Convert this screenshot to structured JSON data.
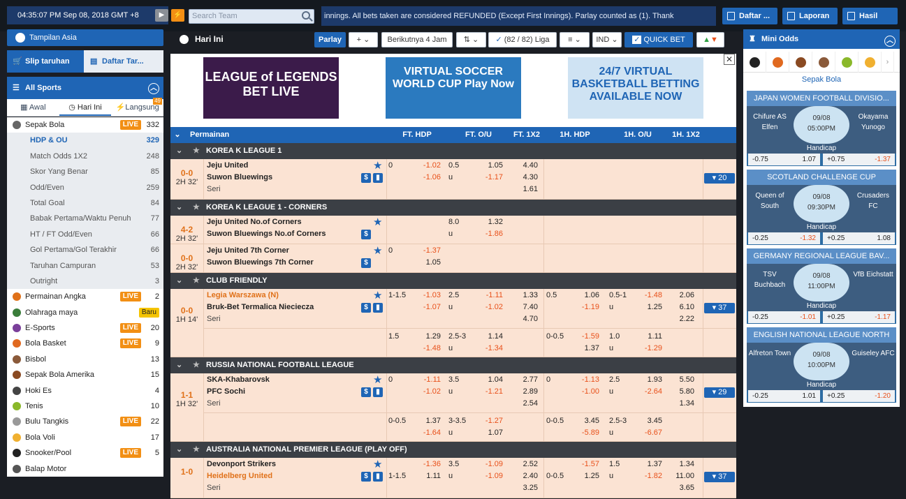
{
  "topbar": {
    "clock": "04:35:07 PM Sep 08, 2018 GMT +8",
    "search_placeholder": "Search Team",
    "ticker": "innings. All bets taken are considered REFUNDED (Except First Innings). Parlay counted as (1). Thank",
    "daftar": "Daftar ...",
    "laporan": "Laporan",
    "hasil": "Hasil"
  },
  "left": {
    "tampilan": "Tampilan Asia",
    "slip": "Slip taruhan",
    "daftar": "Daftar Tar...",
    "all_sports": "All Sports",
    "tabs": [
      "Awal",
      "Hari Ini",
      "Langsung"
    ],
    "langsung_badge": "49",
    "sports": [
      {
        "name": "Sepak Bola",
        "count": "332",
        "live": "LIVE",
        "type": "main"
      },
      {
        "name": "HDP & OU",
        "count": "329",
        "type": "sub-sel"
      },
      {
        "name": "Match Odds 1X2",
        "count": "248",
        "type": "sub"
      },
      {
        "name": "Skor Yang Benar",
        "count": "85",
        "type": "sub"
      },
      {
        "name": "Odd/Even",
        "count": "259",
        "type": "sub"
      },
      {
        "name": "Total Goal",
        "count": "84",
        "type": "sub"
      },
      {
        "name": "Babak Pertama/Waktu Penuh",
        "count": "77",
        "type": "sub"
      },
      {
        "name": "HT / FT Odd/Even",
        "count": "66",
        "type": "sub"
      },
      {
        "name": "Gol Pertama/Gol Terakhir",
        "count": "66",
        "type": "sub"
      },
      {
        "name": "Taruhan Campuran",
        "count": "53",
        "type": "sub"
      },
      {
        "name": "Outright",
        "count": "3",
        "type": "sub"
      },
      {
        "name": "Permainan Angka",
        "count": "2",
        "live": "LIVE",
        "type": "main",
        "color": "#e07119"
      },
      {
        "name": "Olahraga maya",
        "count": "",
        "baru": "Baru",
        "type": "main",
        "color": "#3a7d3a"
      },
      {
        "name": "E-Sports",
        "count": "20",
        "live": "LIVE",
        "type": "main",
        "color": "#7a3f9a"
      },
      {
        "name": "Bola Basket",
        "count": "9",
        "live": "LIVE",
        "type": "main",
        "color": "#e0691f"
      },
      {
        "name": "Bisbol",
        "count": "13",
        "type": "main",
        "color": "#8a5a3a"
      },
      {
        "name": "Sepak Bola Amerika",
        "count": "15",
        "type": "main",
        "color": "#8a4a22"
      },
      {
        "name": "Hoki Es",
        "count": "4",
        "type": "main",
        "color": "#444"
      },
      {
        "name": "Tenis",
        "count": "10",
        "type": "main",
        "color": "#8ab82a"
      },
      {
        "name": "Bulu Tangkis",
        "count": "22",
        "live": "LIVE",
        "type": "main",
        "color": "#999"
      },
      {
        "name": "Bola Voli",
        "count": "17",
        "type": "main",
        "color": "#f0b030"
      },
      {
        "name": "Snooker/Pool",
        "count": "5",
        "live": "LIVE",
        "type": "main",
        "color": "#222"
      },
      {
        "name": "Balap Motor",
        "count": "",
        "type": "main",
        "color": "#555"
      }
    ]
  },
  "center": {
    "title": "Hari Ini",
    "parlay": "Parlay",
    "plus": "+",
    "berikutnya": "Berikutnya 4 Jam",
    "liga": "(82 / 82) Liga",
    "ind": "IND",
    "quickbet": "QUICK BET",
    "banners": [
      "LEAGUE of LEGENDS BET LIVE",
      "VIRTUAL SOCCER WORLD CUP Play Now",
      "24/7 VIRTUAL BASKETBALL BETTING AVAILABLE NOW"
    ],
    "headers": [
      "Permainan",
      "FT. HDP",
      "FT. O/U",
      "FT. 1X2",
      "1H. HDP",
      "1H. O/U",
      "1H. 1X2"
    ]
  },
  "leagues": [
    {
      "name": "KOREA K LEAGUE 1",
      "matches": [
        {
          "score": "0-0",
          "time": "2H 32'",
          "h": "Jeju United",
          "a": "Suwon Bluewings",
          "seri": "Seri",
          "more": "20",
          "lines": [
            [
              "0",
              "-1.02",
              "0.5",
              "1.05",
              "4.40",
              "",
              "",
              "",
              "",
              "",
              ""
            ],
            [
              "",
              "-1.06",
              "u",
              "-1.17",
              "4.30",
              "",
              "",
              "",
              "",
              "",
              ""
            ],
            [
              "",
              "",
              "",
              "",
              "1.61",
              "",
              "",
              "",
              "",
              "",
              ""
            ]
          ]
        }
      ]
    },
    {
      "name": "KOREA K LEAGUE 1 - CORNERS",
      "matches": [
        {
          "score": "4-2",
          "time": "2H 32'",
          "h": "Jeju United No.of Corners",
          "a": "Suwon Bluewings No.of Corners",
          "lines": [
            [
              "",
              "",
              "8.0",
              "1.32"
            ],
            [
              "",
              "",
              "u",
              "-1.86"
            ]
          ]
        },
        {
          "score": "0-0",
          "time": "2H 32'",
          "h": "Jeju United 7th Corner",
          "a": "Suwon Bluewings 7th Corner",
          "lines": [
            [
              "0",
              "-1.37"
            ],
            [
              "",
              "1.05"
            ]
          ]
        }
      ]
    },
    {
      "name": "CLUB FRIENDLY",
      "matches": [
        {
          "score": "0-0",
          "time": "1H 14'",
          "h": "Legia Warszawa (N)",
          "a": "Bruk-Bet Termalica Nieciecza",
          "seri": "Seri",
          "more": "37",
          "lines": [
            [
              "1-1.5",
              "-1.03",
              "2.5",
              "-1.11",
              "1.33",
              "0.5",
              "1.06",
              "0.5-1",
              "-1.48",
              "2.06"
            ],
            [
              "",
              "-1.07",
              "u",
              "-1.02",
              "7.40",
              "",
              "-1.19",
              "u",
              "1.25",
              "6.10"
            ],
            [
              "",
              "",
              "",
              "",
              "4.70",
              "",
              "",
              "",
              "",
              "2.22"
            ],
            [
              "1.5",
              "1.29",
              "2.5-3",
              "1.14",
              "",
              "0-0.5",
              "-1.59",
              "1.0",
              "1.11",
              ""
            ],
            [
              "",
              "-1.48",
              "u",
              "-1.34",
              "",
              "",
              "1.37",
              "u",
              "-1.29",
              ""
            ]
          ]
        }
      ]
    },
    {
      "name": "RUSSIA NATIONAL FOOTBALL LEAGUE",
      "matches": [
        {
          "score": "1-1",
          "time": "1H 32'",
          "h": "SKA-Khabarovsk",
          "a": "PFC Sochi",
          "seri": "Seri",
          "more": "29",
          "lines": [
            [
              "0",
              "-1.11",
              "3.5",
              "1.04",
              "2.77",
              "0",
              "-1.13",
              "2.5",
              "1.93",
              "5.50"
            ],
            [
              "",
              "-1.02",
              "u",
              "-1.21",
              "2.89",
              "",
              "-1.00",
              "u",
              "-2.64",
              "5.80"
            ],
            [
              "",
              "",
              "",
              "",
              "2.54",
              "",
              "",
              "",
              "",
              "1.34"
            ],
            [
              "0-0.5",
              "1.37",
              "3-3.5",
              "-1.27",
              "",
              "0-0.5",
              "3.45",
              "2.5-3",
              "3.45",
              ""
            ],
            [
              "",
              "-1.64",
              "u",
              "1.07",
              "",
              "",
              "-5.89",
              "u",
              "-6.67",
              ""
            ]
          ]
        }
      ]
    },
    {
      "name": "AUSTRALIA NATIONAL PREMIER LEAGUE (PLAY OFF)",
      "matches": [
        {
          "score": "1-0",
          "time": "",
          "h": "Devonport Strikers",
          "a": "Heidelberg United",
          "seri": "Seri",
          "more": "37",
          "lines": [
            [
              "",
              "-1.36",
              "3.5",
              "-1.09",
              "2.52",
              "",
              "-1.57",
              "1.5",
              "1.37",
              "1.34"
            ],
            [
              "1-1.5",
              "1.11",
              "u",
              "-1.09",
              "2.40",
              "0-0.5",
              "1.25",
              "u",
              "-1.82",
              "11.00"
            ],
            [
              "",
              "",
              "",
              "",
              "3.25",
              "",
              "",
              "",
              "",
              "3.65"
            ]
          ]
        }
      ]
    }
  ],
  "right": {
    "title": "Mini Odds",
    "sport": "Sepak Bola",
    "handicap": "Handicap",
    "cards": [
      {
        "league": "JAPAN WOMEN FOOTBALL DIVISIO...",
        "home": "Chifure AS Elfen",
        "away": "Okayama Yunogo",
        "date": "09/08",
        "time": "05:00PM",
        "l1": "-0.75",
        "o1": "1.07",
        "l2": "+0.75",
        "o2": "-1.37"
      },
      {
        "league": "SCOTLAND CHALLENGE CUP",
        "home": "Queen of South",
        "away": "Crusaders FC",
        "date": "09/08",
        "time": "09:30PM",
        "l1": "-0.25",
        "o1": "-1.32",
        "l2": "+0.25",
        "o2": "1.08"
      },
      {
        "league": "GERMANY REGIONAL LEAGUE BAV...",
        "home": "TSV Buchbach",
        "away": "VfB Eichstatt",
        "date": "09/08",
        "time": "11:00PM",
        "l1": "-0.25",
        "o1": "-1.01",
        "l2": "+0.25",
        "o2": "-1.17"
      },
      {
        "league": "ENGLISH NATIONAL LEAGUE NORTH",
        "home": "Alfreton Town",
        "away": "Guiseley AFC",
        "date": "09/08",
        "time": "10:00PM",
        "l1": "-0.25",
        "o1": "1.01",
        "l2": "+0.25",
        "o2": "-1.20"
      }
    ]
  }
}
